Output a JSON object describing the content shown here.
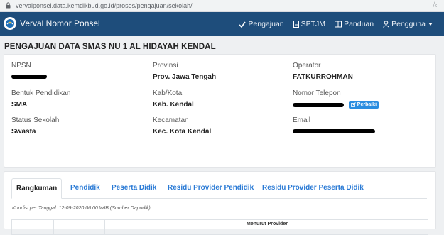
{
  "browser": {
    "url": "vervalponsel.data.kemdikbud.go.id/proses/pengajuan/sekolah/"
  },
  "navbar": {
    "title": "Verval Nomor Ponsel",
    "menu": [
      "Pengajuan",
      "SPTJM",
      "Panduan",
      "Pengguna"
    ]
  },
  "page": {
    "title": "PENGAJUAN DATA SMAS NU 1 AL HIDAYAH KENDAL"
  },
  "school": {
    "npsn_label": "NPSN",
    "provinsi_label": "Provinsi",
    "provinsi": "Prov. Jawa Tengah",
    "operator_label": "Operator",
    "operator": "FATKURROHMAN",
    "bentuk_label": "Bentuk Pendidikan",
    "bentuk": "SMA",
    "kab_label": "Kab/Kota",
    "kab": "Kab. Kendal",
    "telepon_label": "Nomor Telepon",
    "perbaiki_label": "Perbaiki",
    "status_label": "Status Sekolah",
    "status": "Swasta",
    "kecamatan_label": "Kecamatan",
    "kecamatan": "Kec. Kota Kendal",
    "email_label": "Email"
  },
  "tabs": [
    "Rangkuman",
    "Pendidik",
    "Peserta Didik",
    "Residu Provider Pendidik",
    "Residu Provider Peserta Didik"
  ],
  "kondisi": "Kondisi per Tanggal: 12-09-2020 06:00 WIB (Sumber Dapodik)",
  "table": {
    "header_partial": "Menurut Provider"
  },
  "colors": {
    "navbar": "#1e4d7b",
    "link": "#2a7ad5",
    "button": "#2a8de0"
  }
}
